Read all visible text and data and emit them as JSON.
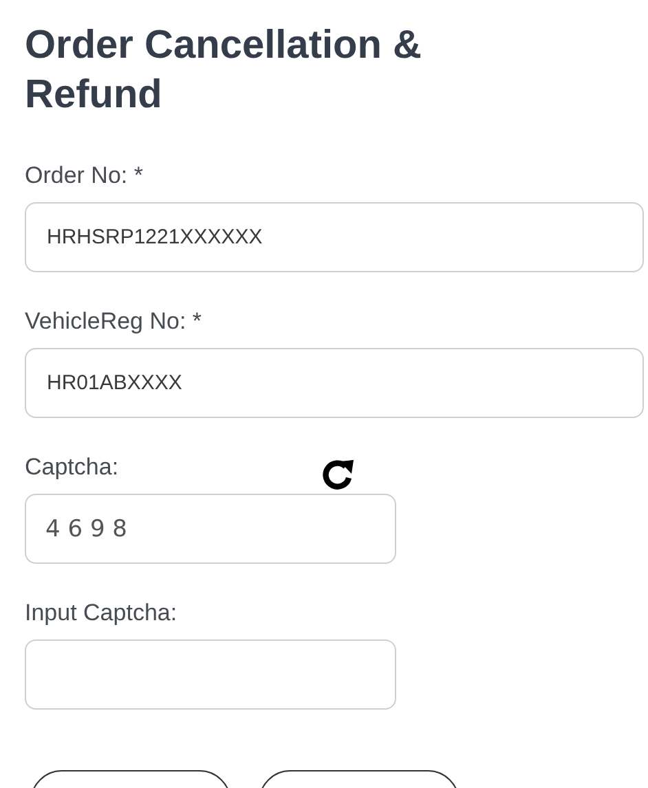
{
  "title": "Order Cancellation & Refund",
  "fields": [
    {
      "kind": "text",
      "label": "Order No: *",
      "value": "HRHSRP1221XXXXXX"
    },
    {
      "kind": "text",
      "label": "VehicleReg No: *",
      "value": "HR01ABXXXX"
    },
    {
      "kind": "captcha",
      "label": "Captcha:",
      "value": "4 6 9 8"
    },
    {
      "kind": "input",
      "label": "Input Captcha:"
    }
  ],
  "buttons": [
    {
      "kind": "outline"
    },
    {
      "kind": "outline"
    }
  ]
}
